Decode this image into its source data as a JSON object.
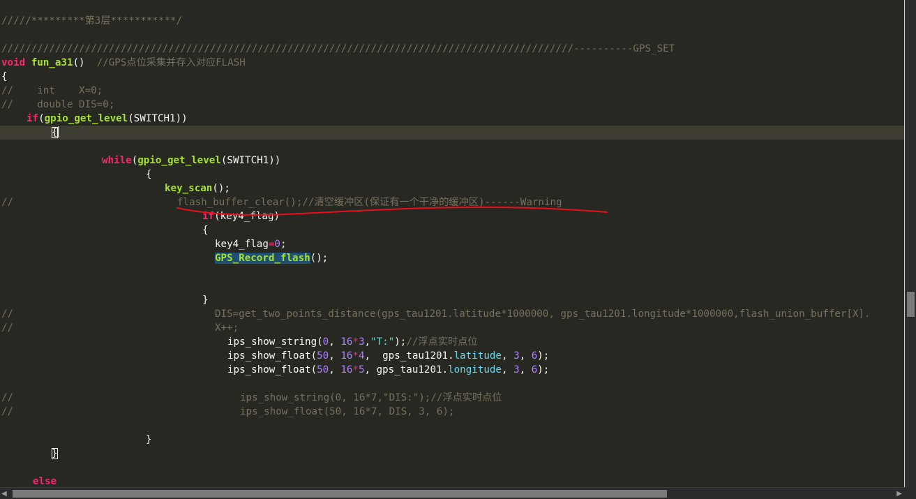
{
  "code": {
    "l01": "/////*********第3层***********/",
    "l03_comment": "////////////////////////////////////////////////////////////////////////////////////////////////----------GPS_SET",
    "l04_type": "void",
    "l04_fn": "fun_a31",
    "l04_parens": "()  ",
    "l04_comment": "//GPS点位采集并存入对应FLASH",
    "l05": "{",
    "l06": "//    int    X=0;",
    "l07": "//    double DIS=0;",
    "l08_if": "if",
    "l08_open": "(",
    "l08_fn": "gpio_get_level",
    "l08_rest": "(SWITCH1))",
    "l09_brace": "{",
    "l11_while": "while",
    "l11_open": "(",
    "l11_fn": "gpio_get_level",
    "l11_rest": "(SWITCH1))",
    "l12": "{",
    "l13_fn": "key_scan",
    "l13_rest": "();",
    "l14_slashes": "//",
    "l14_code": "flash_buffer_clear();//清空缓冲区(保证有一个干净的缓冲区)------Warning",
    "l15_if": "if",
    "l15_rest": "(key4_flag)",
    "l16": "{",
    "l17_var": "key4_flag",
    "l17_eq": "=",
    "l17_num": "0",
    "l17_end": ";",
    "l18_fn": "GPS_Record_flash",
    "l18_rest": "();",
    "l21": "}",
    "l22_slashes": "//",
    "l22_code": "DIS=get_two_points_distance(gps_tau1201.latitude*1000000, gps_tau1201.longitude*1000000,flash_union_buffer[X].",
    "l23_slashes": "//",
    "l23_code": "X++;",
    "l24_fn": "ips_show_string(",
    "l24_n1": "0",
    "l24_c1": ", ",
    "l24_n2": "16",
    "l24_op": "*",
    "l24_n3": "3",
    "l24_c2": ",",
    "l24_str": "\"T:\"",
    "l24_end": ");",
    "l24_cmt": "//浮点实时点位",
    "l25_fn": "ips_show_float(",
    "l25_n1": "50",
    "l25_c1": ", ",
    "l25_n2": "16",
    "l25_op": "*",
    "l25_n3": "4",
    "l25_c2": ",  gps_tau1201.",
    "l25_mem": "latitude",
    "l25_c3": ", ",
    "l25_n4": "3",
    "l25_c4": ", ",
    "l25_n5": "6",
    "l25_end": ");",
    "l26_fn": "ips_show_float(",
    "l26_n1": "50",
    "l26_c1": ", ",
    "l26_n2": "16",
    "l26_op": "*",
    "l26_n3": "5",
    "l26_c2": ", gps_tau1201.",
    "l26_mem": "longitude",
    "l26_c3": ", ",
    "l26_n4": "3",
    "l26_c4": ", ",
    "l26_n5": "6",
    "l26_end": ");",
    "l28_slashes": "//",
    "l28_code": "ips_show_string(0, 16*7,\"DIS:\");//浮点实时点位",
    "l29_slashes": "//",
    "l29_code": "ips_show_float(50, 16*7, DIS, 3, 6);",
    "l31": "}",
    "l32": "}",
    "l34": "else"
  },
  "colors": {
    "background": "#272822",
    "keyword": "#f92672",
    "function": "#a6e22e",
    "comment": "#75715e",
    "number": "#ae81ff",
    "string": "#5fd3d0",
    "annotation": "#e8101c"
  },
  "cursor_line": 10
}
